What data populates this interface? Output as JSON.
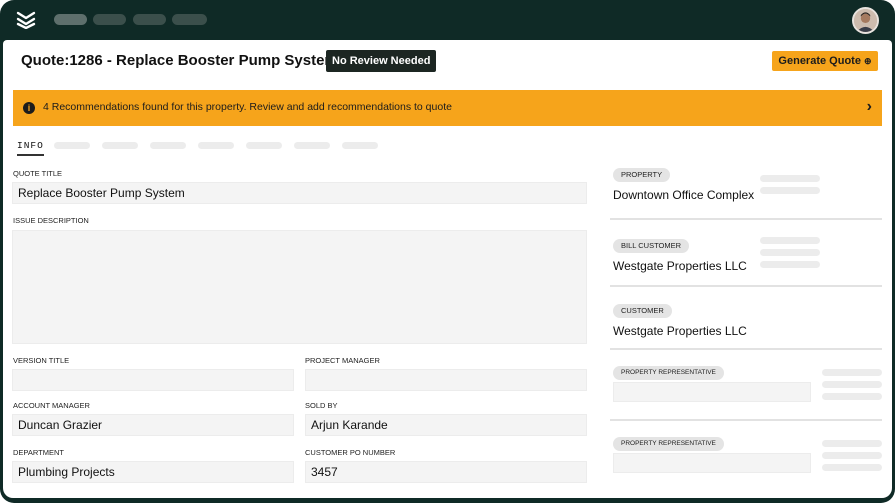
{
  "header": {
    "title": "Quote:1286 - Replace Booster Pump System",
    "badge": "No Review Needed",
    "generate_label": "Generate Quote",
    "generate_icon": "arrow-circle-icon"
  },
  "banner": {
    "icon": "info-icon",
    "text": "4 Recommendations found for this property. Review and add recommendations to quote",
    "chevron": "›"
  },
  "tabs": {
    "active": "INFO"
  },
  "form": {
    "quote_title_label": "QUOTE TITLE",
    "quote_title_value": "Replace Booster Pump System",
    "issue_description_label": "ISSUE DESCRIPTION",
    "issue_description_value": "",
    "version_title_label": "VERSION TITLE",
    "version_title_value": "",
    "project_manager_label": "PROJECT MANAGER",
    "project_manager_value": "",
    "account_manager_label": "ACCOUNT MANAGER",
    "account_manager_value": "Duncan Grazier",
    "sold_by_label": "SOLD BY",
    "sold_by_value": "Arjun Karande",
    "department_label": "DEPARTMENT",
    "department_value": "Plumbing Projects",
    "customer_po_label": "CUSTOMER PO NUMBER",
    "customer_po_value": "3457"
  },
  "sidebar": {
    "property_chip": "PROPERTY",
    "property_value": "Downtown Office Complex",
    "bill_customer_chip": "BILL CUSTOMER",
    "bill_customer_value": "Westgate Properties LLC",
    "customer_chip": "CUSTOMER",
    "customer_value": "Westgate Properties LLC",
    "rep1_chip": "PROPERTY REPRESENTATIVE",
    "rep2_chip": "PROPERTY REPRESENTATIVE"
  },
  "colors": {
    "accent": "#f6a41b",
    "nav_bg": "#0f2a26",
    "badge_bg": "#1c2622"
  }
}
